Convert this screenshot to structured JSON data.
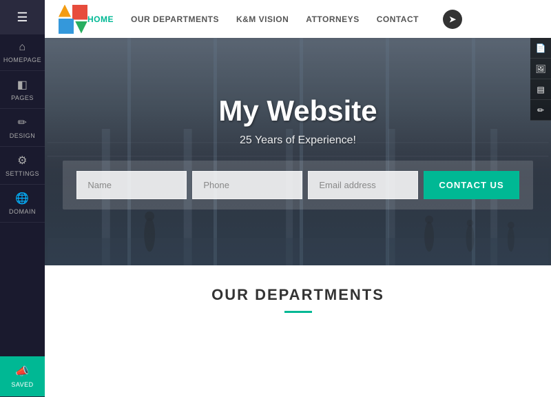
{
  "sidebar": {
    "menu_icon": "☰",
    "items": [
      {
        "id": "homepage",
        "label": "HOMEPAGE",
        "icon": "⌂"
      },
      {
        "id": "pages",
        "label": "PAGES",
        "icon": "◧"
      },
      {
        "id": "design",
        "label": "DESIGN",
        "icon": "✏"
      },
      {
        "id": "settings",
        "label": "SETTINGS",
        "icon": "⚙"
      },
      {
        "id": "domain",
        "label": "DOMAIN",
        "icon": "🌐"
      },
      {
        "id": "saved",
        "label": "Saved",
        "icon": "📣"
      }
    ]
  },
  "navbar": {
    "nav_items": [
      {
        "id": "home",
        "label": "HOME",
        "active": true
      },
      {
        "id": "departments",
        "label": "OUR DEPARTMENTS",
        "active": false
      },
      {
        "id": "vision",
        "label": "K&M VISION",
        "active": false
      },
      {
        "id": "attorneys",
        "label": "ATTORNEYS",
        "active": false
      },
      {
        "id": "contact",
        "label": "CONTACT",
        "active": false
      }
    ]
  },
  "hero": {
    "title": "My Website",
    "subtitle": "25 Years of Experience!",
    "form": {
      "name_placeholder": "Name",
      "phone_placeholder": "Phone",
      "email_placeholder": "Email address",
      "button_label": "CONTACT US"
    }
  },
  "departments": {
    "title": "OUR DEPARTMENTS"
  },
  "toolbar": {
    "icons": [
      "📄",
      "🖼",
      "▤",
      "✏"
    ]
  },
  "colors": {
    "accent": "#00b894",
    "sidebar_bg": "#1a1a2e",
    "nav_bg": "#ffffff"
  }
}
